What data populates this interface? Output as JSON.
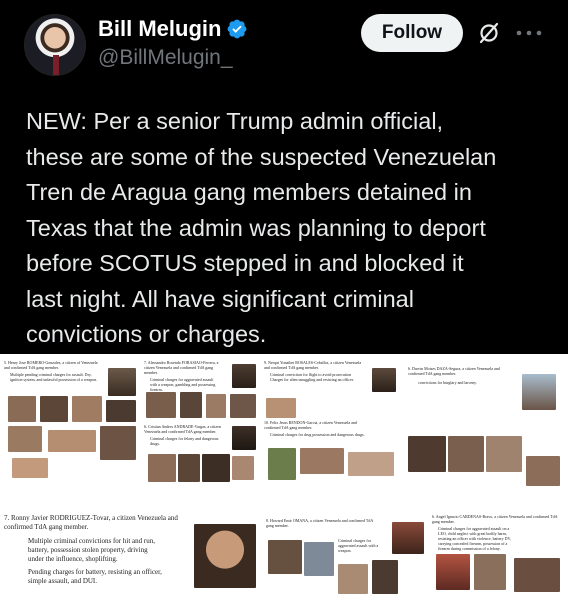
{
  "author": {
    "name": "Bill Melugin",
    "handle": "@BillMelugin_",
    "verified": true
  },
  "actions": {
    "follow_label": "Follow",
    "grok_icon": "grok-slash-icon",
    "more_icon": "more-dots-icon"
  },
  "tweet": {
    "lines": [
      "NEW: Per a senior Trump admin official,",
      "these are some of the suspected Venezuelan",
      "Tren de Aragua gang members detained in",
      "Texas that the admin was planning to deport",
      "before SCOTUS stepped in and blocked it",
      "last night. All have significant criminal",
      "convictions or charges."
    ]
  },
  "documents": {
    "d1": {
      "heading": "5. Henry Jose ROMERO-Gonzalez, a citizen of Venezuela and confirmed TdA gang member.",
      "bullet": "Multiple pending criminal charges for assault. Dry, ignition system, and unlawful possession of a weapon."
    },
    "d2": {
      "heading": "7. Alessandro Rosendo FORASIAO-Ferrera, a citizen Venezuela and confirmed TdA gang member.",
      "bullet": "Criminal charges for aggravated assault with a weapon, gambling and possessing firearm."
    },
    "d3": {
      "heading": "9. Nerqui Yonaibet ROSALES-Ceballos, a citizen Venezuela and confirmed TdA gang member.",
      "bullets": [
        "Criminal conviction for flight to avoid prosecution",
        "Charges for alien smuggling and resisting an officer."
      ]
    },
    "d4": {
      "heading": "6. Darvin Moises DAZA-Segura, a citizen Venezuela and confirmed TdA gang member.",
      "bullet": "convictions for burglary and larceny."
    },
    "d5": {
      "heading": "6. Cristian Andres ANDRADE-Vargas, a citizen Venezuela and confirmed TdA gang member.",
      "bullet": "Criminal charges for felony and dangerous drugs."
    },
    "d6": {
      "heading": "10. Felix Jesus RENDON-Garcia, a citizen Venezuela and confirmed TdA gang member.",
      "bullet": "Criminal charges for drug possession and dangerous drugs."
    },
    "d7": {
      "heading_line1": "7.   Ronny Javier RODRIGUEZ-Tovar, a citizen   Venezuela and",
      "heading_line2": "confirmed TdA gang member.",
      "bullets": [
        "Multiple criminal convictions for hit and run, battery, possession stolen property, driving under the influence, shoplifting.",
        "Pending charges for battery, resisting an officer, simple assault, and DUI."
      ]
    },
    "d8": {
      "heading": "8. Howard Emir OMANA, a citizen Venezuela and confirmed TdA gang member.",
      "bullet": "Criminal charges for aggravated assault with a weapon."
    },
    "d9": {
      "heading": "6. Angel Ignacio CARDENAS-Bravo, a citizen Venezuela and confirmed TdA gang member.",
      "bullets": [
        "Criminal charges for aggravated assault on a LEO, child neglect with great bodily harm, resisting an officer with violence, battery DV, carrying concealed firearm, possession of a firearm during commission of a felony."
      ]
    }
  }
}
